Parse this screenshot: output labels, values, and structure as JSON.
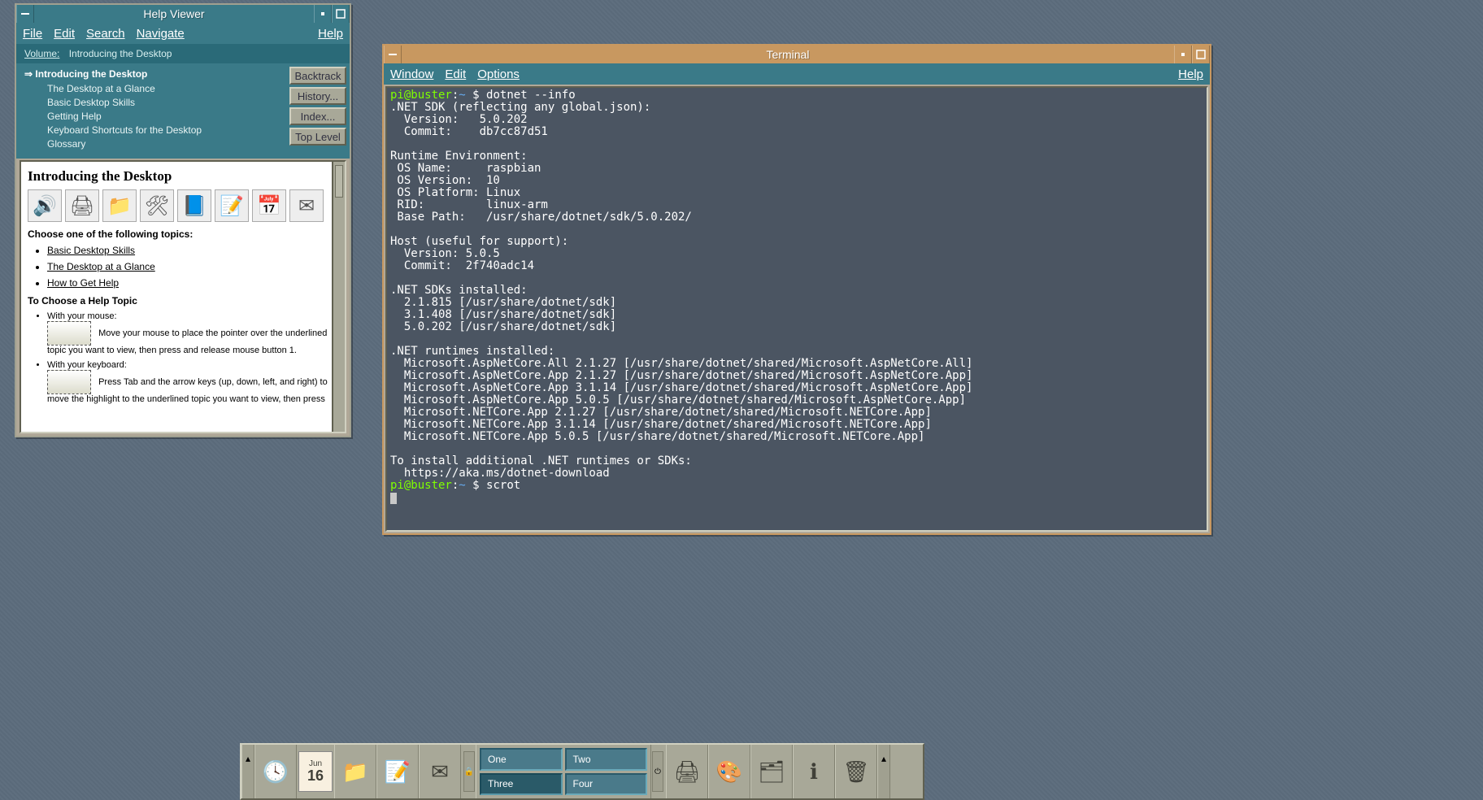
{
  "helpviewer": {
    "title": "Help Viewer",
    "menus": {
      "file": "File",
      "edit": "Edit",
      "search": "Search",
      "navigate": "Navigate",
      "help": "Help"
    },
    "volume_label": "Volume:",
    "volume_value": "Introducing the Desktop",
    "toc_root": "Introducing the Desktop",
    "toc_items": [
      "The Desktop at a Glance",
      "Basic Desktop Skills",
      "Getting Help",
      "Keyboard Shortcuts for the Desktop",
      "Glossary"
    ],
    "buttons": {
      "backtrack": "Backtrack",
      "history": "History...",
      "index": "Index...",
      "toplevel": "Top Level"
    },
    "content": {
      "heading": "Introducing the Desktop",
      "choose_label": "Choose one of the following topics:",
      "links": [
        "Basic Desktop Skills",
        "The Desktop at a Glance",
        "How to Get Help"
      ],
      "to_choose_heading": "To Choose a Help Topic",
      "mouse_label": "With your mouse:",
      "mouse_text": "Move your mouse to place the pointer over the underlined topic you want to view, then press and release mouse button 1.",
      "keyboard_label": "With your keyboard:",
      "keyboard_text": "Press Tab and the arrow keys (up, down, left, and right) to move the highlight to the underlined topic you want to view, then press"
    }
  },
  "terminal": {
    "title": "Terminal",
    "menus": {
      "window": "Window",
      "edit": "Edit",
      "options": "Options",
      "help": "Help"
    },
    "prompt_user": "pi@buster",
    "prompt_path": "~",
    "prompt_symbol": "$",
    "cmd1": "dotnet --info",
    "cmd2": "scrot",
    "output": ".NET SDK (reflecting any global.json):\n  Version:   5.0.202\n  Commit:    db7cc87d51\n\nRuntime Environment:\n OS Name:     raspbian\n OS Version:  10\n OS Platform: Linux\n RID:         linux-arm\n Base Path:   /usr/share/dotnet/sdk/5.0.202/\n\nHost (useful for support):\n  Version: 5.0.5\n  Commit:  2f740adc14\n\n.NET SDKs installed:\n  2.1.815 [/usr/share/dotnet/sdk]\n  3.1.408 [/usr/share/dotnet/sdk]\n  5.0.202 [/usr/share/dotnet/sdk]\n\n.NET runtimes installed:\n  Microsoft.AspNetCore.All 2.1.27 [/usr/share/dotnet/shared/Microsoft.AspNetCore.All]\n  Microsoft.AspNetCore.App 2.1.27 [/usr/share/dotnet/shared/Microsoft.AspNetCore.App]\n  Microsoft.AspNetCore.App 3.1.14 [/usr/share/dotnet/shared/Microsoft.AspNetCore.App]\n  Microsoft.AspNetCore.App 5.0.5 [/usr/share/dotnet/shared/Microsoft.AspNetCore.App]\n  Microsoft.NETCore.App 2.1.27 [/usr/share/dotnet/shared/Microsoft.NETCore.App]\n  Microsoft.NETCore.App 3.1.14 [/usr/share/dotnet/shared/Microsoft.NETCore.App]\n  Microsoft.NETCore.App 5.0.5 [/usr/share/dotnet/shared/Microsoft.NETCore.App]\n\nTo install additional .NET runtimes or SDKs:\n  https://aka.ms/dotnet-download"
  },
  "panel": {
    "date_month": "Jun",
    "date_day": "16",
    "workspaces": [
      "One",
      "Two",
      "Three",
      "Four"
    ],
    "active_ws": 2
  }
}
